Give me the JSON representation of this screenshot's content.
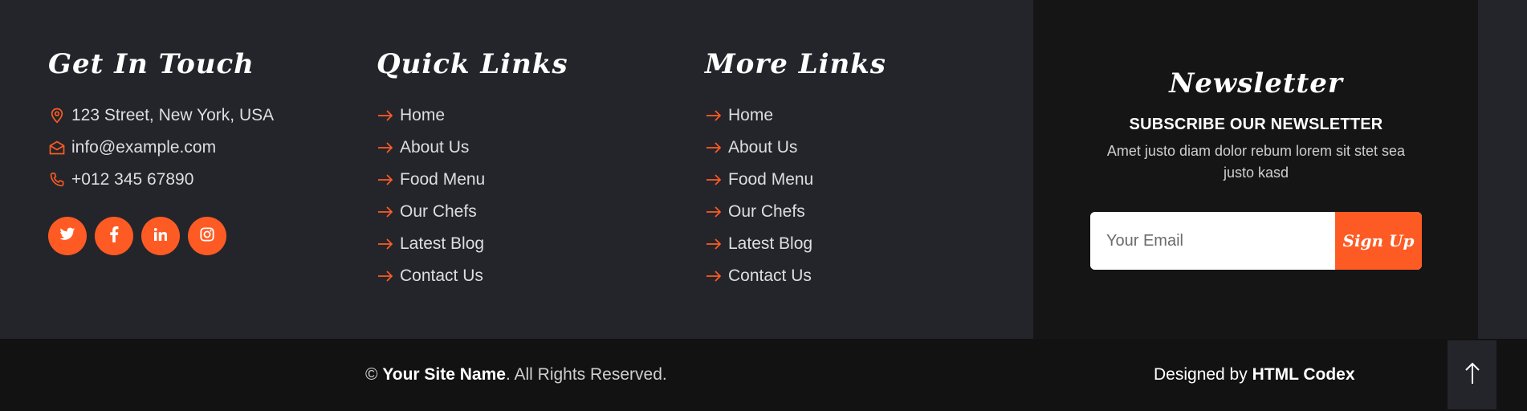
{
  "colors": {
    "accent": "#fe5b24",
    "panel": "#24252b",
    "dark": "#151515",
    "text": "#dedede"
  },
  "contact": {
    "title": "Get In Touch",
    "items": [
      {
        "icon": "map-pin-icon",
        "text": "123 Street, New York, USA"
      },
      {
        "icon": "envelope-icon",
        "text": "info@example.com"
      },
      {
        "icon": "phone-icon",
        "text": "+012 345 67890"
      }
    ],
    "socials": [
      "twitter-icon",
      "facebook-icon",
      "linkedin-icon",
      "instagram-icon"
    ]
  },
  "quick_links": {
    "title": "Quick Links",
    "items": [
      "Home",
      "About Us",
      "Food Menu",
      "Our Chefs",
      "Latest Blog",
      "Contact Us"
    ]
  },
  "more_links": {
    "title": "More Links",
    "items": [
      "Home",
      "About Us",
      "Food Menu",
      "Our Chefs",
      "Latest Blog",
      "Contact Us"
    ]
  },
  "newsletter": {
    "title": "Newsletter",
    "subtitle": "SUBSCRIBE OUR NEWSLETTER",
    "text": "Amet justo diam dolor rebum lorem sit stet sea justo kasd",
    "placeholder": "Your Email",
    "button": "Sign Up"
  },
  "bottom": {
    "copyright_prefix": "© ",
    "site_name": "Your Site Name",
    "copyright_suffix": ". All Rights Reserved.",
    "designed_prefix": "Designed by ",
    "designer": "HTML Codex"
  }
}
